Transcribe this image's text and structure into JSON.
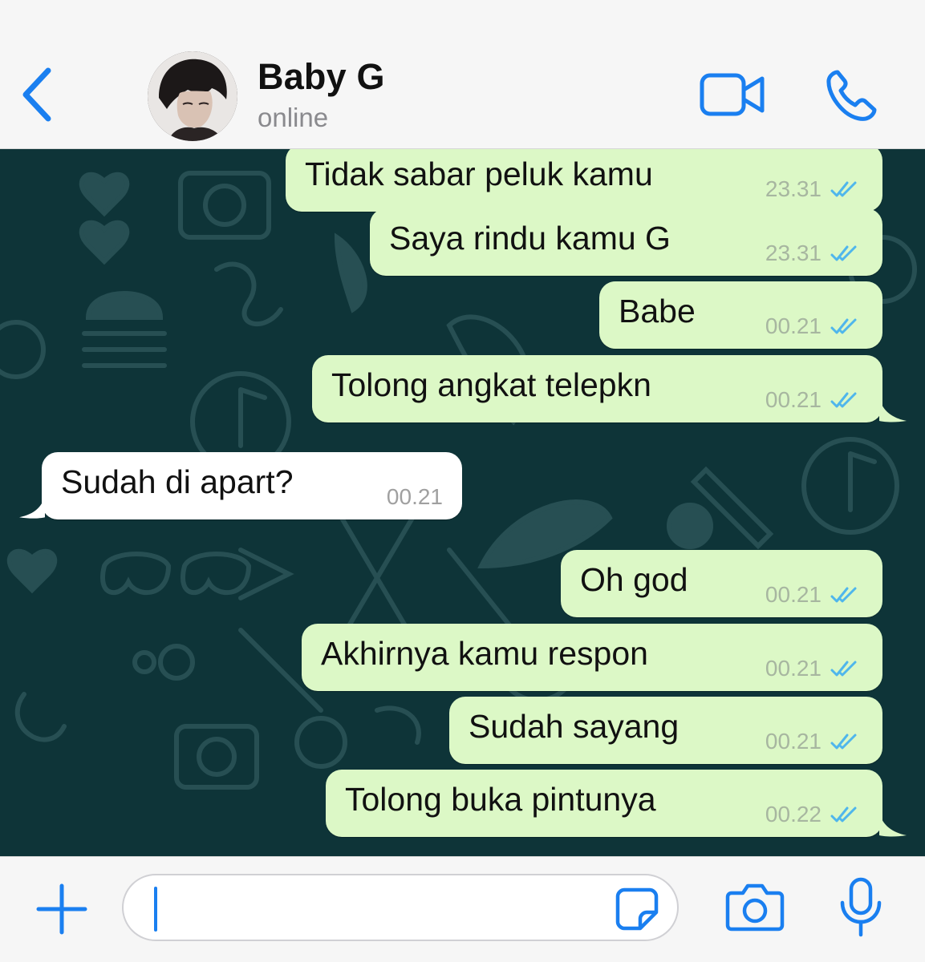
{
  "header": {
    "contact_name": "Baby G",
    "status": "online"
  },
  "messages": [
    {
      "direction": "out",
      "text": "Tidak sabar peluk kamu",
      "time": "23.31",
      "read": true
    },
    {
      "direction": "out",
      "text": "Saya rindu kamu G",
      "time": "23.31",
      "read": true
    },
    {
      "direction": "out",
      "text": "Babe",
      "time": "00.21",
      "read": true
    },
    {
      "direction": "out",
      "text": "Tolong angkat telepkn",
      "time": "00.21",
      "read": true
    },
    {
      "direction": "in",
      "text": "Sudah di apart?",
      "time": "00.21"
    },
    {
      "direction": "out",
      "text": "Oh god",
      "time": "00.21",
      "read": true
    },
    {
      "direction": "out",
      "text": "Akhirnya kamu respon",
      "time": "00.21",
      "read": true
    },
    {
      "direction": "out",
      "text": "Sudah sayang",
      "time": "00.21",
      "read": true
    },
    {
      "direction": "out",
      "text": "Tolong buka pintunya",
      "time": "00.22",
      "read": true
    }
  ],
  "input": {
    "value": ""
  },
  "colors": {
    "accent": "#1a7ff0",
    "outgoing_bubble": "#dcf8c6",
    "incoming_bubble": "#ffffff",
    "chat_background": "#0e3438",
    "read_ticks": "#4fb6ec"
  },
  "icons": {
    "back": "chevron-left-icon",
    "video": "video-camera-icon",
    "call": "phone-icon",
    "attach": "plus-icon",
    "sticker": "sticker-icon",
    "camera": "camera-icon",
    "mic": "microphone-icon"
  }
}
